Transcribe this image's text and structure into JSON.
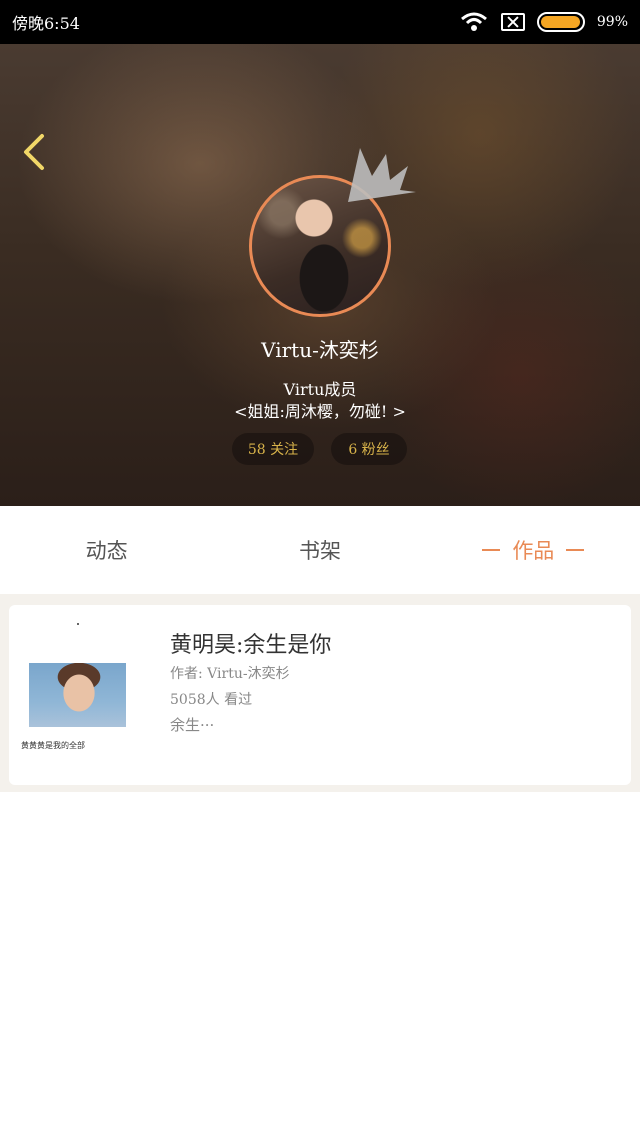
{
  "status_bar": {
    "time": "傍晚6:54",
    "battery_percent": "99%",
    "battery_level": 0.99,
    "icons": [
      "wifi-icon",
      "sim-icon",
      "battery-icon"
    ]
  },
  "profile": {
    "username": "Virtu-沐奕杉",
    "bio_line1": "Virtu成员",
    "bio_line2": "<姐姐:周沐樱，勿碰! >",
    "follow_label": "58 关注",
    "fans_label": "6 粉丝",
    "accent_color": "#e98a55"
  },
  "tabs": [
    {
      "label": "动态",
      "active": false
    },
    {
      "label": "书架",
      "active": false
    },
    {
      "label": "作品",
      "active": true
    }
  ],
  "works": [
    {
      "cover_caption": "黄黄黄是我的全部",
      "title": "黄明昊:余生是你",
      "author": "作者: Virtu-沐奕杉",
      "views": "5058人 看过",
      "excerpt": "余生···"
    }
  ]
}
